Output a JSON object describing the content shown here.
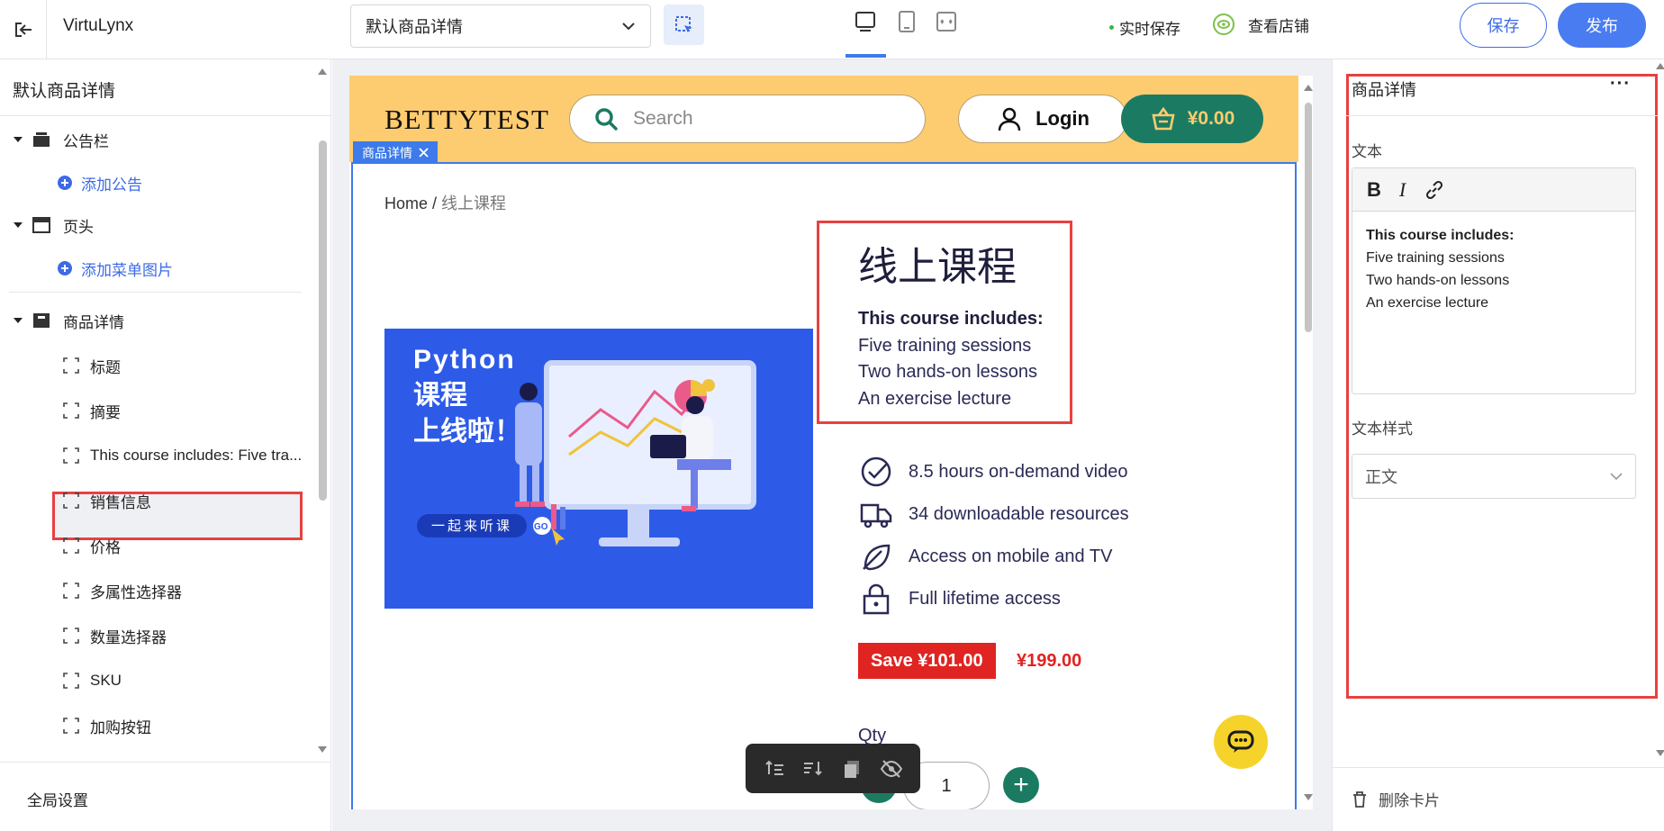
{
  "header": {
    "app_name": "VirtuLynx",
    "page_select": "默认商品详情",
    "live_save": "实时保存",
    "view_store": "查看店铺",
    "save_label": "保存",
    "publish_label": "发布"
  },
  "left_panel": {
    "title": "默认商品详情",
    "sections": [
      {
        "label": "公告栏",
        "add_label": "添加公告"
      },
      {
        "label": "页头",
        "add_label": "添加菜单图片"
      },
      {
        "label": "商品详情"
      }
    ],
    "items": [
      "标题",
      "摘要",
      "This course includes: Five tra...",
      "销售信息",
      "价格",
      "多属性选择器",
      "数量选择器",
      "SKU",
      "加购按钮"
    ],
    "footer": "全局设置"
  },
  "preview": {
    "brand": "BETTYTEST",
    "search_placeholder": "Search",
    "login_label": "Login",
    "cart_total": "¥0.00",
    "tag_label": "商品详情",
    "breadcrumb_home": "Home",
    "breadcrumb_sep": " / ",
    "breadcrumb_current": "线上课程",
    "product_title": "线上课程",
    "desc_heading": "This course includes:",
    "desc_lines": [
      "Five training sessions",
      "Two hands-on lessons",
      "An exercise lecture"
    ],
    "features": [
      "8.5 hours on-demand video",
      "34 downloadable resources",
      "Access on mobile and TV",
      "Full lifetime access"
    ],
    "save_badge": "Save ¥101.00",
    "price": "¥199.00",
    "qty_label": "Qty",
    "qty_value": "1",
    "image_text": {
      "line1": "Python",
      "line2": "课程",
      "line3": "上线啦！",
      "pill": "一起来听课",
      "go": "GO"
    }
  },
  "right_panel": {
    "title": "商品详情",
    "text_label": "文本",
    "editor_heading": "This course includes:",
    "editor_lines": [
      "Five training sessions",
      "Two hands-on lessons",
      "An exercise lecture"
    ],
    "style_label": "文本样式",
    "style_value": "正文",
    "delete_label": "删除卡片"
  },
  "colors": {
    "accent": "#3d7bea",
    "highlight": "#e84040",
    "shop_bar": "#fecc70",
    "shop_green": "#1b7b62",
    "price_red": "#e02421"
  }
}
